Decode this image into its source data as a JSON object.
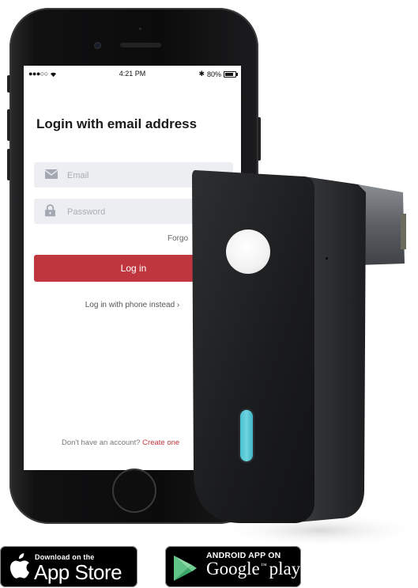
{
  "status_bar": {
    "signal": "●●●○○",
    "time": "4:21 PM",
    "bluetooth": "✱",
    "battery_text": "80%",
    "battery_level": 0.8
  },
  "login": {
    "title": "Login with email address",
    "email_placeholder": "Email",
    "password_placeholder": "Password",
    "forgot_label": "Forgo",
    "login_button": "Log in",
    "phone_link": "Log in with phone instead",
    "signup_prompt": "Don't have an account?",
    "create_link": "Create one"
  },
  "badges": {
    "appstore_small": "Download on the",
    "appstore_big": "App Store",
    "googleplay_small": "ANDROID APP ON",
    "googleplay_big_1": "Google",
    "googleplay_big_2": "play"
  },
  "icons": {
    "email": "envelope-icon",
    "password": "lock-icon",
    "apple": "apple-icon",
    "play": "google-play-icon"
  },
  "colors": {
    "brand_red": "#c0363e",
    "field_bg": "#eceef2",
    "device_accent": "#47bfd0"
  }
}
